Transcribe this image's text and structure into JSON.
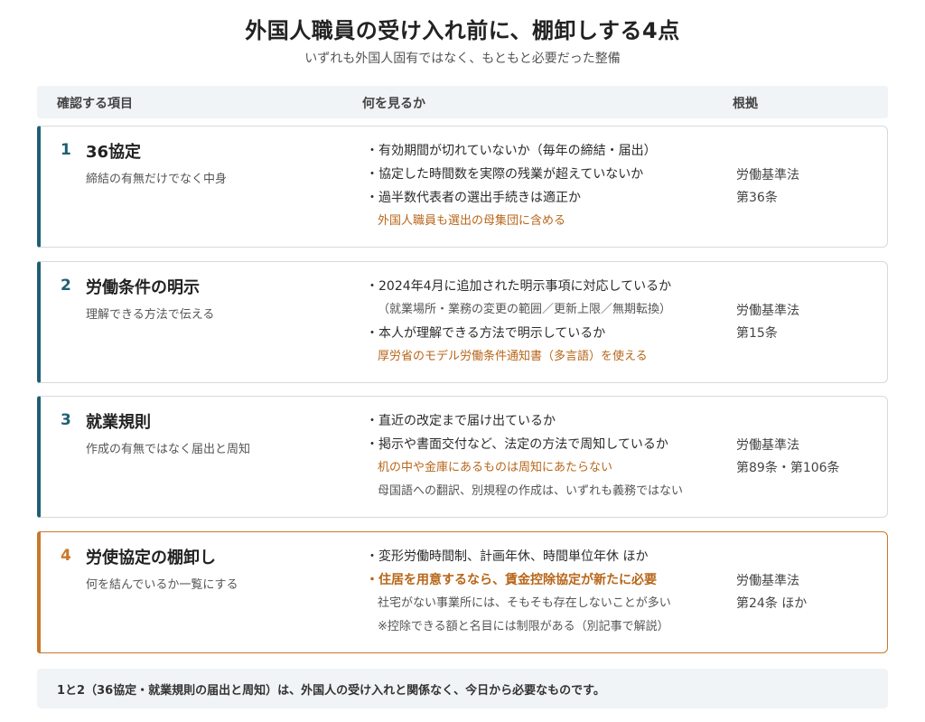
{
  "title": "外国人職員の受け入れ前に、棚卸しする4点",
  "subtitle": "いずれも外国人固有ではなく、もともと必要だった整備",
  "header": {
    "item": "確認する項目",
    "what": "何を見るか",
    "basis": "根拠"
  },
  "rows": [
    {
      "num": "1",
      "title": "36協定",
      "sub": "締結の有無だけでなく中身",
      "points": [
        "・有効期間が切れていないか（毎年の締結・届出）",
        "・協定した時間数を実際の残業が超えていないか",
        "・過半数代表者の選出手続きは適正か",
        "外国人職員も選出の母集団に含める"
      ],
      "basis": [
        "労働基準法",
        "第36条"
      ]
    },
    {
      "num": "2",
      "title": "労働条件の明示",
      "sub": "理解できる方法で伝える",
      "points": [
        "・2024年4月に追加された明示事項に対応しているか",
        "（就業場所・業務の変更の範囲／更新上限／無期転換）",
        "・本人が理解できる方法で明示しているか",
        "厚労省のモデル労働条件通知書（多言語）を使える"
      ],
      "basis": [
        "労働基準法",
        "第15条"
      ]
    },
    {
      "num": "3",
      "title": "就業規則",
      "sub": "作成の有無ではなく届出と周知",
      "points": [
        "・直近の改定まで届け出ているか",
        "・掲示や書面交付など、法定の方法で周知しているか",
        "机の中や金庫にあるものは周知にあたらない",
        "母国語への翻訳、別規程の作成は、いずれも義務ではない"
      ],
      "basis": [
        "労働基準法",
        "第89条・第106条"
      ]
    },
    {
      "num": "4",
      "title": "労使協定の棚卸し",
      "sub": "何を結んでいるか一覧にする",
      "points": [
        "・変形労働時間制、計画年休、時間単位年休 ほか",
        "・住居を用意するなら、賃金控除協定が新たに必要",
        "社宅がない事業所には、そもそも存在しないことが多い",
        "※控除できる額と名目には制限がある（別記事で解説）"
      ],
      "basis": [
        "労働基準法",
        "第24条 ほか"
      ]
    }
  ],
  "footer": "1と2（36協定・就業規則の届出と周知）は、外国人の受け入れと関係なく、今日から必要なものです。",
  "colors": {
    "accent": "#1f5f73",
    "warning": "#c9782a",
    "highlight_text": "#b8661a",
    "header_bg": "#f1f4f6"
  }
}
